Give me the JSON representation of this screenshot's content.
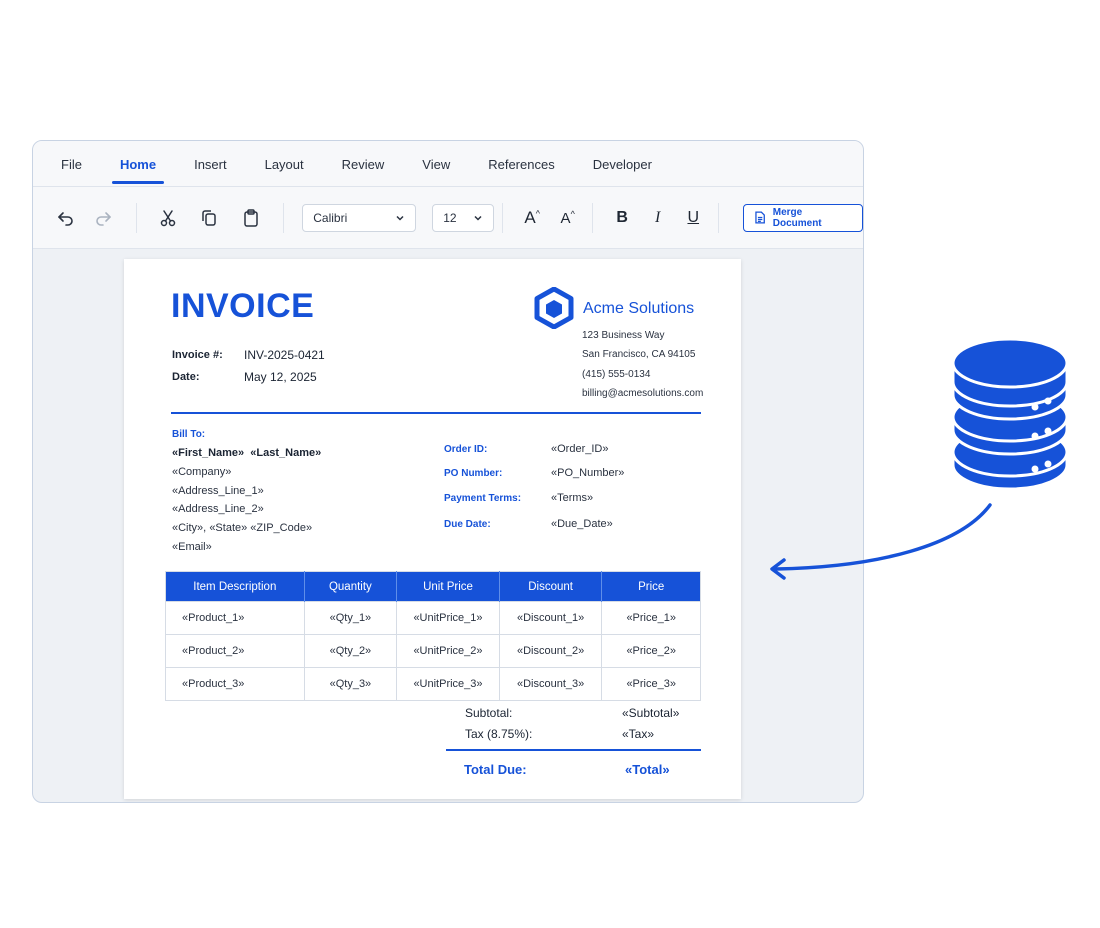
{
  "tabs": [
    "File",
    "Home",
    "Insert",
    "Layout",
    "Review",
    "View",
    "References",
    "Developer"
  ],
  "active_tab": "Home",
  "toolbar": {
    "font": "Calibri",
    "size": "12",
    "merge_label": "Merge Document"
  },
  "invoice": {
    "title": "INVOICE",
    "number_label": "Invoice #:",
    "number": "INV-2025-0421",
    "date_label": "Date:",
    "date": "May 12, 2025"
  },
  "company": {
    "name": "Acme Solutions",
    "address1": "123 Business Way",
    "address2": "San Francisco, CA 94105",
    "phone": "(415) 555-0134",
    "email": "billing@acmesolutions.com"
  },
  "bill_to": {
    "label": "Bill To:",
    "name_first": "«First_Name»",
    "name_last": "«Last_Name»",
    "company": "«Company»",
    "address1": "«Address_Line_1»",
    "address2": "«Address_Line_2»",
    "city": "«City»,",
    "state": "«State»",
    "zip": "«ZIP_Code»",
    "email": "«Email»"
  },
  "order": {
    "order_id_label": "Order ID:",
    "order_id": "«Order_ID»",
    "po_label": "PO Number:",
    "po": "«PO_Number»",
    "terms_label": "Payment Terms:",
    "terms": "«Terms»",
    "due_label": "Due Date:",
    "due": "«Due_Date»"
  },
  "table": {
    "headers": [
      "Item Description",
      "Quantity",
      "Unit Price",
      "Discount",
      "Price"
    ],
    "rows": [
      [
        "«Product_1»",
        "«Qty_1»",
        "«UnitPrice_1»",
        "«Discount_1»",
        "«Price_1»"
      ],
      [
        "«Product_2»",
        "«Qty_2»",
        "«UnitPrice_2»",
        "«Discount_2»",
        "«Price_2»"
      ],
      [
        "«Product_3»",
        "«Qty_3»",
        "«UnitPrice_3»",
        "«Discount_3»",
        "«Price_3»"
      ]
    ]
  },
  "totals": {
    "subtotal_label": "Subtotal:",
    "subtotal": "«Subtotal»",
    "tax_label": "Tax (8.75%):",
    "tax": "«Tax»",
    "total_label": "Total Due:",
    "total": "«Total»"
  },
  "colors": {
    "accent": "#1652d8",
    "database": "#1652d8"
  },
  "icons": [
    "undo-icon",
    "redo-icon",
    "cut-icon",
    "copy-icon",
    "paste-icon",
    "chevron-down-icon",
    "document-icon",
    "hexagon-logo-icon",
    "database-icon",
    "arrow-icon"
  ]
}
